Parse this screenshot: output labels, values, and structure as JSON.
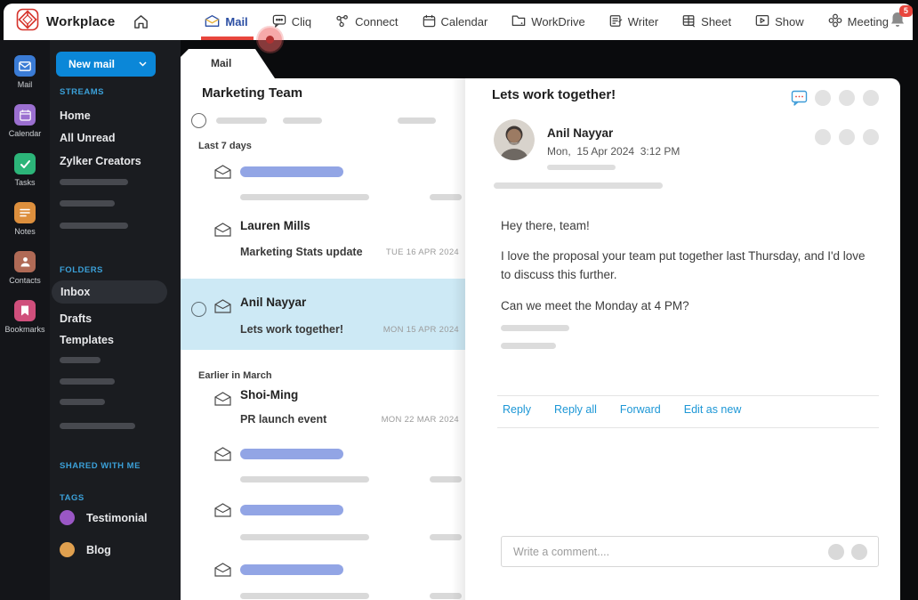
{
  "topbar": {
    "brand": "Workplace",
    "nav": [
      {
        "label": "Mail",
        "active": true
      },
      {
        "label": "Cliq"
      },
      {
        "label": "Connect"
      },
      {
        "label": "Calendar"
      },
      {
        "label": "WorkDrive"
      },
      {
        "label": "Writer"
      },
      {
        "label": "Sheet"
      },
      {
        "label": "Show"
      },
      {
        "label": "Meeting"
      }
    ],
    "notification_count": "5"
  },
  "rail": {
    "items": [
      {
        "label": "Mail"
      },
      {
        "label": "Calendar"
      },
      {
        "label": "Tasks"
      },
      {
        "label": "Notes"
      },
      {
        "label": "Contacts"
      },
      {
        "label": "Bookmarks"
      }
    ]
  },
  "sidebar": {
    "new_mail_label": "New mail",
    "streams_title": "STREAMS",
    "streams": [
      {
        "label": "Home"
      },
      {
        "label": "All Unread"
      },
      {
        "label": "Zylker Creators"
      }
    ],
    "folders_title": "FOLDERS",
    "folders": [
      {
        "label": "Inbox",
        "selected": true
      },
      {
        "label": "Drafts"
      },
      {
        "label": "Templates"
      }
    ],
    "shared_title": "SHARED WITH ME",
    "tags_title": "TAGS",
    "tags": [
      {
        "label": "Testimonial",
        "color": "#9a57c5"
      },
      {
        "label": "Blog",
        "color": "#e0a04f"
      }
    ]
  },
  "mail_list": {
    "tab": "Mail",
    "title": "Marketing Team",
    "groups": [
      "Last 7 days",
      "Earlier in March"
    ],
    "emails": [
      {
        "sender": "Lauren Mills",
        "subject": "Marketing Stats update",
        "date": "TUE 16 APR 2024"
      },
      {
        "sender": "Anil Nayyar",
        "subject": "Lets work together!",
        "date": "MON 15 APR 2024",
        "selected": true
      },
      {
        "sender": "Shoi-Ming",
        "subject": "PR launch event",
        "date": "MON 22 MAR 2024"
      }
    ]
  },
  "reader": {
    "subject": "Lets work together!",
    "sender": "Anil Nayyar",
    "datetime": "Mon,  15 Apr 2024  3:12 PM",
    "body": {
      "p1": "Hey there, team!",
      "p2": "I love the proposal your team put together last Thursday, and I'd love to discuss this further.",
      "p3": "Can we meet the Monday at 4 PM?"
    },
    "actions": [
      {
        "label": "Reply"
      },
      {
        "label": "Reply all"
      },
      {
        "label": "Forward"
      },
      {
        "label": "Edit as new"
      }
    ],
    "comment_placeholder": "Write a comment...."
  },
  "colors": {
    "accent_blue": "#0b87d8",
    "active_nav_blue": "#2b4ea3",
    "underline_red": "#e8463d",
    "badge_red": "#e8463d",
    "selected_row_blue": "#cde9f5",
    "link_blue": "#1d97d6",
    "skeleton_blue": "#92a5e5",
    "section_label_blue": "#3ba0d8"
  }
}
